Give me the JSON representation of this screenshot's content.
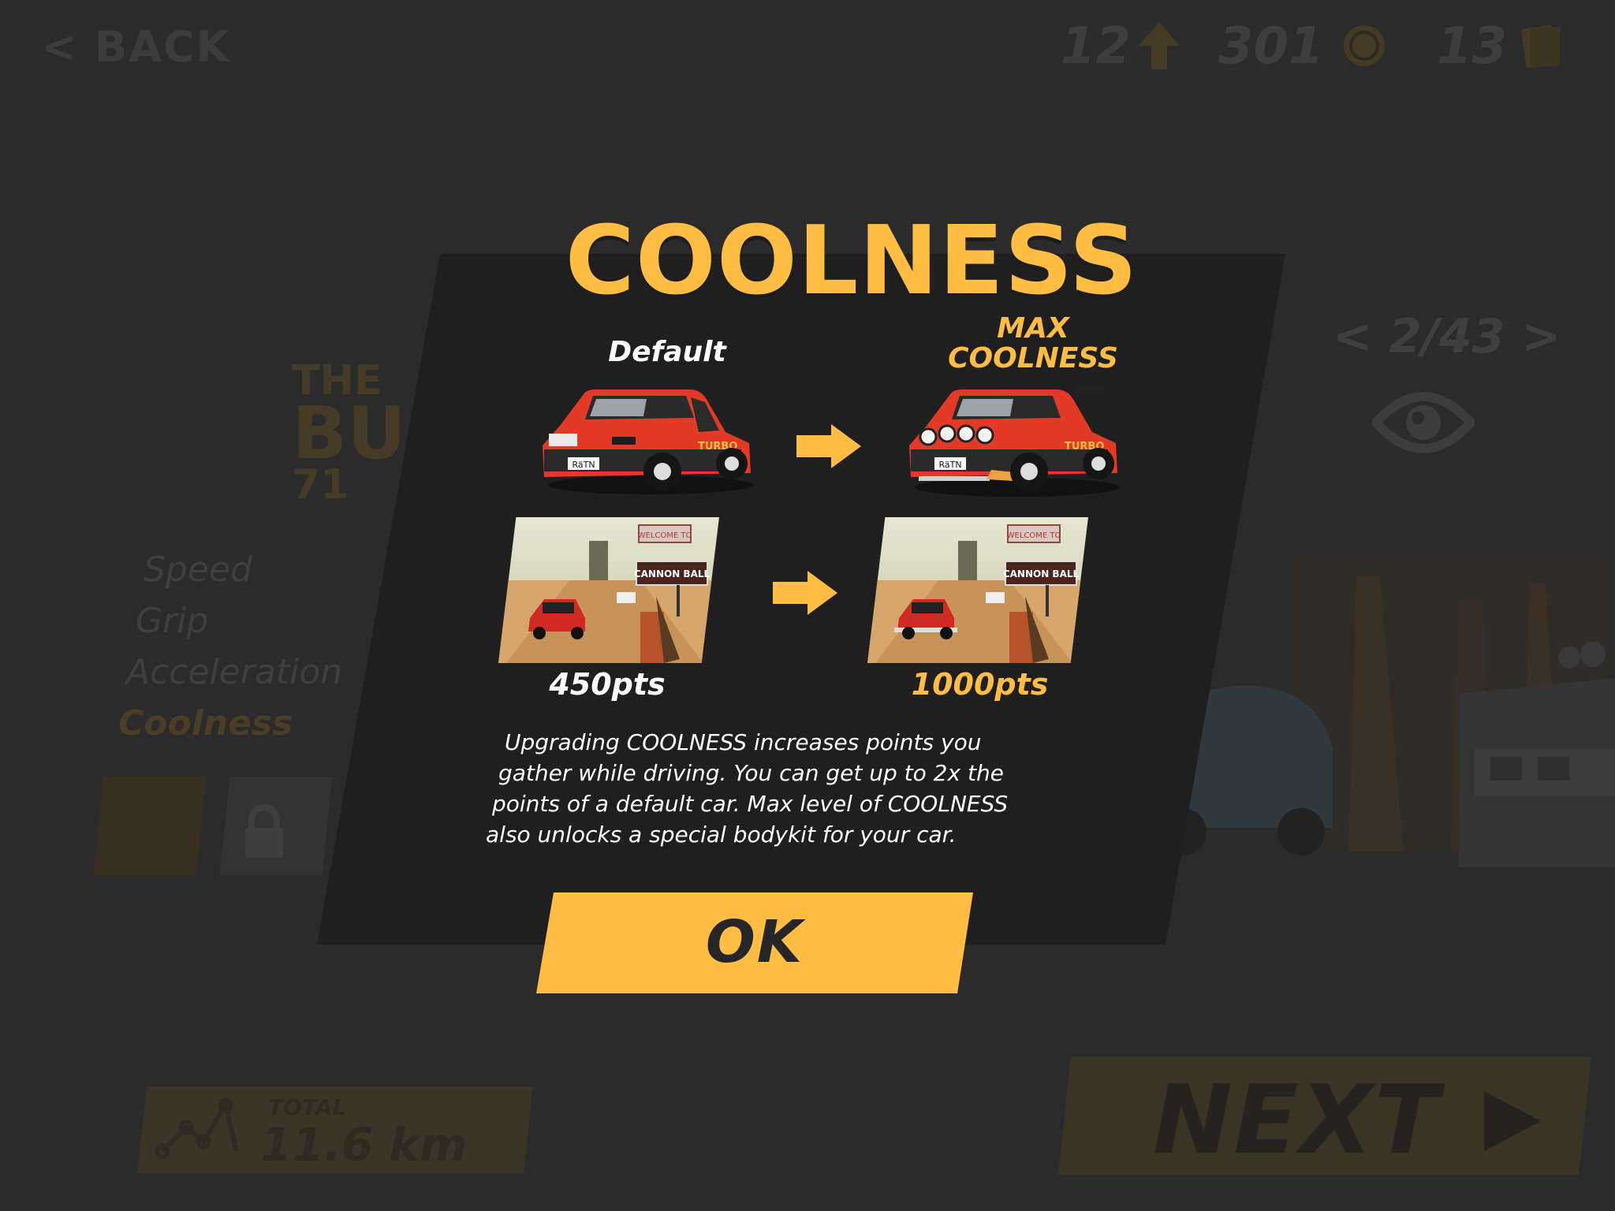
{
  "header": {
    "back_label": "< BACK",
    "levels": "12",
    "coins": "301",
    "cards": "13"
  },
  "background": {
    "car_name_line1": "THE",
    "car_name_line2": "BUGGER",
    "car_name_line3": "71",
    "pager": "< 2/43 >",
    "stats": [
      "Speed",
      "Grip",
      "Acceleration",
      "Coolness"
    ],
    "total_label": "TOTAL",
    "total_value": "11.6 km",
    "next_label": "NEXT"
  },
  "modal": {
    "title": "COOLNESS",
    "default_label": "Default",
    "max_label_line1": "MAX",
    "max_label_line2": "COOLNESS",
    "default_points": "450pts",
    "max_points": "1000pts",
    "description": [
      "Upgrading COOLNESS increases points you",
      "gather while driving. You can get up to 2x the",
      "points of a default car. Max level of COOLNESS",
      "also unlocks a special bodykit for your car."
    ],
    "ok_label": "OK",
    "billboard_top": "WELCOME TO",
    "billboard_sign": "CANNON BALL",
    "plate": "RäTN",
    "decal": "TURBO"
  },
  "colors": {
    "accent": "#ffbd44",
    "panel": "#1e1e1e",
    "background": "#2b2b2b",
    "car_red": "#e33a28"
  }
}
